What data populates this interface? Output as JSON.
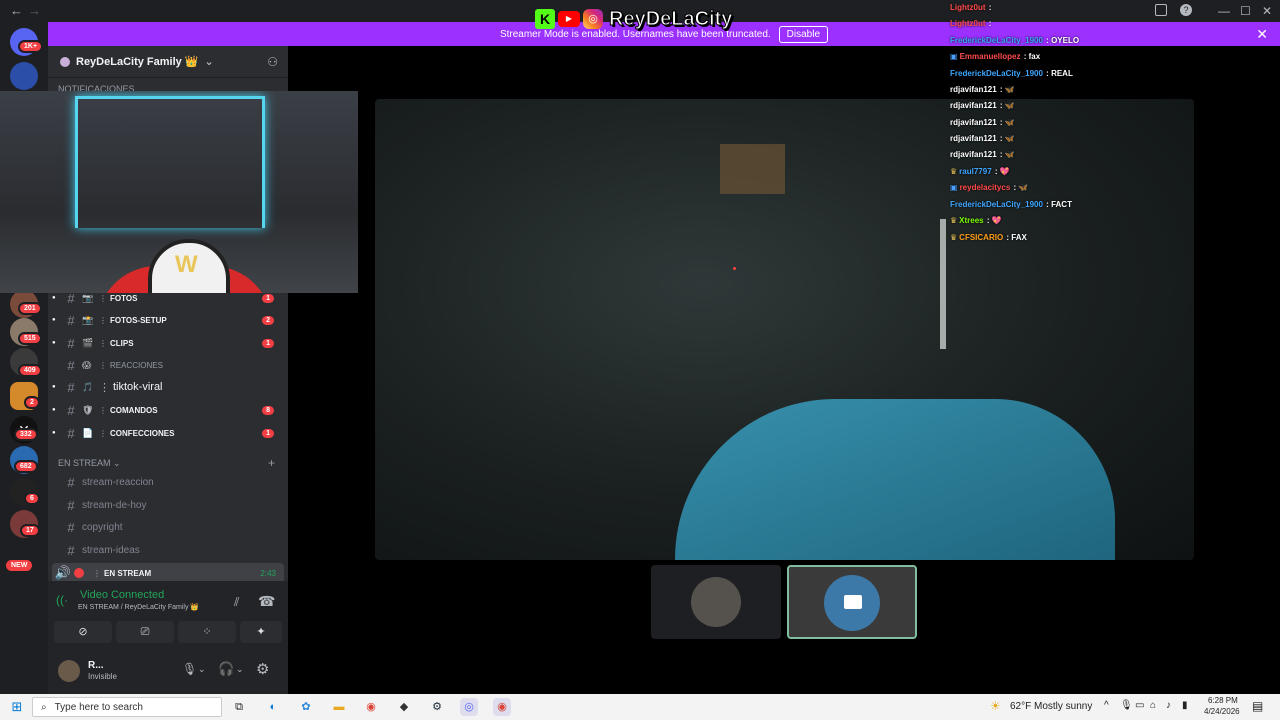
{
  "window": {
    "back_glyph": "←",
    "forward_glyph": "→",
    "title_partial": "ReyDeLaCity Family",
    "controls": [
      "—",
      "☐",
      "✕"
    ]
  },
  "banner": {
    "text": "Streamer Mode is enabled. Usernames have been truncated.",
    "disable_label": "Disable",
    "close_glyph": "✕"
  },
  "rail": {
    "badges": [
      "1K+",
      "201",
      "515",
      "409",
      "2",
      "332",
      "682",
      "6",
      "17",
      "NEW"
    ]
  },
  "server": {
    "name": "ReyDeLaCity Family 👑",
    "chevron": "⌄",
    "invite_glyph": "⚇"
  },
  "categories": {
    "notifications": "NOTIFICACIONES",
    "en_stream": "EN STREAM ⌄"
  },
  "channels": [
    {
      "emoji": "📷",
      "name": "FOTOS",
      "count": "1"
    },
    {
      "emoji": "📸",
      "name": "FOTOS-SETUP",
      "count": "2"
    },
    {
      "emoji": "🎬",
      "name": "CLIPS",
      "count": "1"
    },
    {
      "emoji": "😱",
      "name": "REACCIONES",
      "count": ""
    },
    {
      "emoji": "🎵",
      "name": "tiktok-viral",
      "count": ""
    },
    {
      "emoji": "🛡",
      "name": "COMANDOS",
      "count": "8"
    },
    {
      "emoji": "📄",
      "name": "CONFECCIONES",
      "count": "1"
    }
  ],
  "stream_channels": [
    "stream-reaccion",
    "stream-de-hoy",
    "copyright",
    "stream-ideas"
  ],
  "voice_channel": {
    "name": "EN STREAM",
    "time": "2:43"
  },
  "voice_panel": {
    "status": "Video Connected",
    "location": "EN STREAM / ReyDeLaCity Family 👑",
    "buttons": [
      "⊘",
      "⎚",
      "⁘",
      "✦"
    ]
  },
  "user": {
    "name": "R...",
    "status": "Invisible"
  },
  "logo": {
    "k": "K",
    "yt": "▶",
    "ig": "◎",
    "name": "ReyDeLaCity"
  },
  "chat": [
    {
      "user": "Lightz0ut",
      "text": "",
      "color": "#ff4b4b"
    },
    {
      "user": "Lightz0ut",
      "text": "",
      "color": "#ff4b4b"
    },
    {
      "user": "FrederickDeLaCity_1900",
      "text": "OYELO",
      "color": "#3ea6ff"
    },
    {
      "user": "Emmanuellopez",
      "text": "fax",
      "color": "#ff4b4b"
    },
    {
      "user": "FrederickDeLaCity_1900",
      "text": "REAL",
      "color": "#3ea6ff"
    },
    {
      "user": "rdjavifan121",
      "text": "🦋",
      "color": "#ffffff"
    },
    {
      "user": "rdjavifan121",
      "text": "🦋",
      "color": "#ffffff"
    },
    {
      "user": "rdjavifan121",
      "text": "🦋",
      "color": "#ffffff"
    },
    {
      "user": "rdjavifan121",
      "text": "🦋",
      "color": "#ffffff"
    },
    {
      "user": "rdjavifan121",
      "text": "🦋",
      "color": "#ffffff"
    },
    {
      "user": "raul7797",
      "text": "💖",
      "color": "#3ea6ff"
    },
    {
      "user": "reydelacitycs",
      "text": "🦋",
      "color": "#ff4b4b"
    },
    {
      "user": "FrederickDeLaCity_1900",
      "text": "FACT",
      "color": "#3ea6ff"
    },
    {
      "user": "Xtrees",
      "text": "💖",
      "color": "#7cfc00"
    },
    {
      "user": "CFSICARIO",
      "text": "FAX",
      "color": "#ff9f1a"
    }
  ],
  "taskbar": {
    "search_placeholder": "Type here to search",
    "weather_temp": "62°F",
    "weather_text": "Mostly sunny",
    "time": "6:28 PM",
    "date": "4/24/2026"
  }
}
